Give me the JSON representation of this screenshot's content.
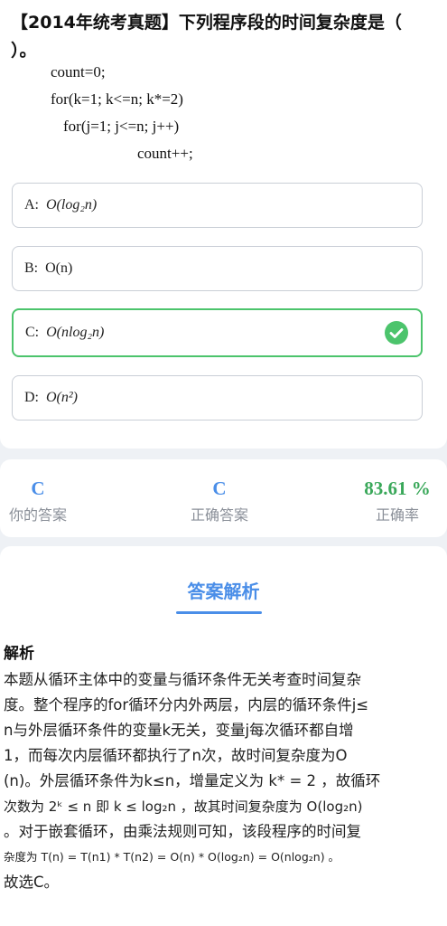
{
  "question": {
    "title_line1": "【2014年统考真题】下列程序段的时间复杂度是（",
    "title_line2": "）。",
    "code_lines": [
      "count=0;",
      "for(k=1; k<=n; k*=2)",
      "for(j=1; j<=n; j++)",
      "count++;"
    ]
  },
  "options": [
    {
      "letter": "A:",
      "text": "O(log₂n)",
      "state": "normal"
    },
    {
      "letter": "B:",
      "text": "O(n)",
      "state": "normal"
    },
    {
      "letter": "C:",
      "text": "O(nlog₂n)",
      "state": "correct"
    },
    {
      "letter": "D:",
      "text": "O(n²)",
      "state": "normal"
    }
  ],
  "stats": {
    "your_answer": {
      "value": "C",
      "label": "你的答案"
    },
    "correct_answer": {
      "value": "C",
      "label": "正确答案"
    },
    "accuracy": {
      "value": "83.61 %",
      "label": "正确率"
    }
  },
  "analysis": {
    "heading": "答案解析",
    "subheading": "解析",
    "lines": [
      "本题从循环主体中的变量与循环条件无关考查时间复杂",
      "度。整个程序的for循环分内外两层，内层的循环条件j≤",
      "n与外层循环条件的变量k无关，变量j每次循环都自增",
      "1，而每次内层循环都执行了n次，故时间复杂度为O",
      "(n)。外层循环条件为k≤n，增量定义为 k* = 2 ，故循环",
      "次数为 2ᵏ ≤ n 即 k ≤ log₂n ，故其时间复杂度为 O(log₂n)",
      "。对于嵌套循环，由乘法规则可知，该段程序的时间复",
      "杂度为 T(n) = T(n1) * T(n2) = O(n) * O(log₂n) = O(nlog₂n) 。",
      "故选C。"
    ]
  },
  "colors": {
    "accent_blue": "#4a8ee8",
    "correct_green": "#4cc46c",
    "stat_green": "#3aa85a"
  },
  "icons": {
    "correct_indicator": "check-circle-icon"
  }
}
